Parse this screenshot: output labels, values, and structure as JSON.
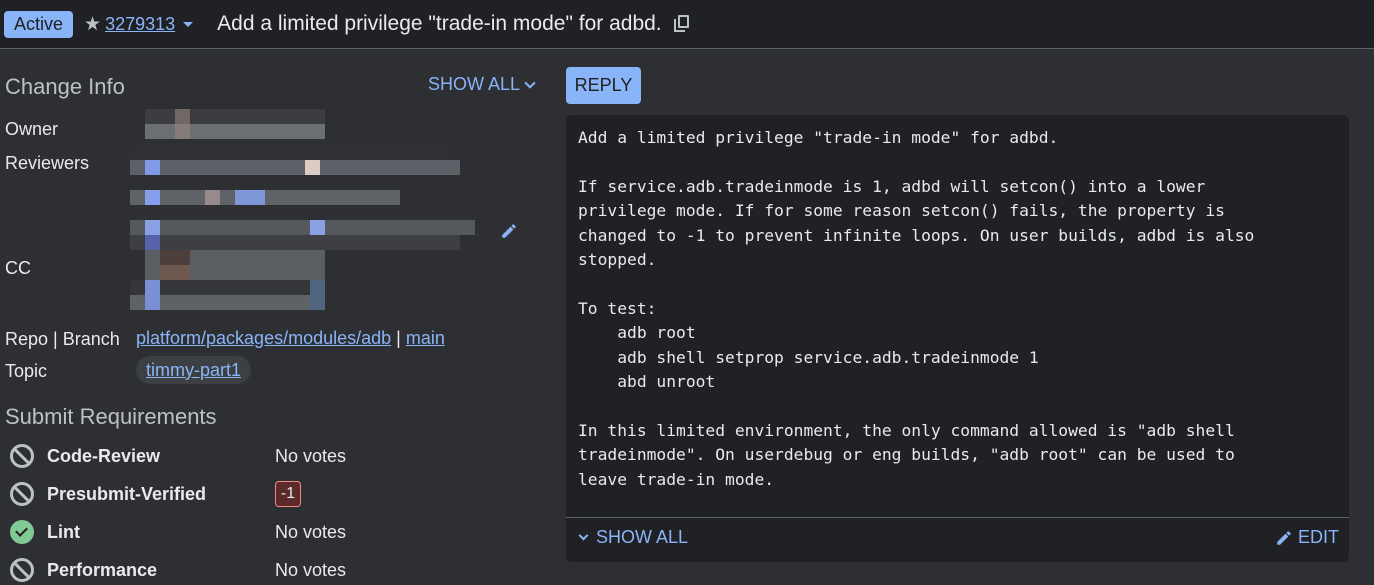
{
  "header": {
    "status": "Active",
    "change_number": "3279313",
    "title": "Add a limited privilege \"trade-in mode\" for adbd.",
    "icons": {
      "star": "star-icon",
      "dropdown": "caret-down-icon",
      "copy": "copy-icon"
    }
  },
  "change_info": {
    "title": "Change Info",
    "show_all": "SHOW ALL",
    "labels": {
      "owner": "Owner",
      "reviewers": "Reviewers",
      "cc": "CC",
      "repo_branch": "Repo | Branch",
      "topic": "Topic"
    },
    "repo": "platform/packages/modules/adb",
    "separator": "|",
    "branch": "main",
    "topic": "timmy-part1",
    "redacted_note": "pixelated (redacted) owner/reviewer/cc names"
  },
  "submit_requirements": {
    "title": "Submit Requirements",
    "items": [
      {
        "name": "Code-Review",
        "status": "blocked",
        "value": "No votes"
      },
      {
        "name": "Presubmit-Verified",
        "status": "blocked",
        "value": "-1"
      },
      {
        "name": "Lint",
        "status": "satisfied",
        "value": "No votes"
      },
      {
        "name": "Performance",
        "status": "blocked",
        "value": "No votes"
      }
    ]
  },
  "commit_message": {
    "reply_label": "REPLY",
    "lines": [
      "Add a limited privilege \"trade-in mode\" for adbd.",
      "",
      "If service.adb.tradeinmode is 1, adbd will setcon() into a lower",
      "privilege mode. If for some reason setcon() fails, the property is",
      "changed to -1 to prevent infinite loops. On user builds, adbd is also",
      "stopped.",
      "",
      "To test:",
      "    adb root",
      "    adb shell setprop service.adb.tradeinmode 1",
      "    abd unroot",
      "",
      "In this limited environment, the only command allowed is \"adb shell",
      "tradeinmode\". On userdebug or eng builds, \"adb root\" can be used to",
      "leave trade-in mode."
    ],
    "show_all": "SHOW ALL",
    "edit": "EDIT"
  },
  "colors": {
    "accent": "#8ab4f8",
    "background": "#2e2f33",
    "header_bg": "#202124",
    "card_bg": "#202124",
    "ok_green": "#81c995",
    "negative_vote_bg": "#5c2b29",
    "negative_vote_border": "#f28b82"
  }
}
